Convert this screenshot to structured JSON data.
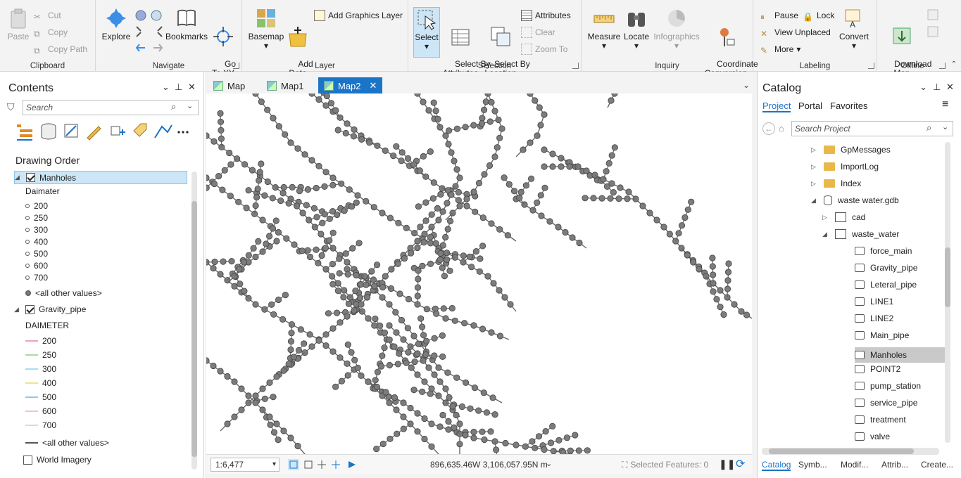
{
  "ribbon": {
    "clipboard": {
      "label": "Clipboard",
      "paste": "Paste",
      "cut": "Cut",
      "copy": "Copy",
      "copy_path": "Copy Path"
    },
    "navigate": {
      "label": "Navigate",
      "explore": "Explore",
      "bookmarks": "Bookmarks",
      "go_to_xy": "Go\nTo XY"
    },
    "layer": {
      "label": "Layer",
      "basemap": "Basemap",
      "add_data": "Add\nData",
      "add_graphics_layer": "Add Graphics Layer"
    },
    "selection": {
      "label": "Selection",
      "select": "Select",
      "select_by_attributes": "Select By\nAttributes",
      "select_by_location": "Select By\nLocation",
      "attributes": "Attributes",
      "clear": "Clear",
      "zoom_to": "Zoom To"
    },
    "inquiry": {
      "label": "Inquiry",
      "measure": "Measure",
      "locate": "Locate",
      "infographics": "Infographics",
      "coordinate_conversion": "Coordinate\nConversion"
    },
    "labeling": {
      "label": "Labeling",
      "pause": "Pause",
      "lock": "Lock",
      "view_unplaced": "View Unplaced",
      "more": "More",
      "convert": "Convert"
    },
    "offline": {
      "label": "Offline",
      "download_map": "Download\nMap"
    }
  },
  "contents": {
    "title": "Contents",
    "search_placeholder": "Search",
    "drawing_order": "Drawing Order",
    "manholes": {
      "name": "Manholes",
      "field": "Daimater",
      "classes": [
        "200",
        "250",
        "300",
        "400",
        "500",
        "600",
        "700"
      ],
      "other": "<all other values>"
    },
    "gravity_pipe": {
      "name": "Gravity_pipe",
      "field": "DAIMETER",
      "classes": [
        "200",
        "250",
        "300",
        "400",
        "500",
        "600",
        "700"
      ],
      "class_colors": [
        "#f2a0b5",
        "#a0e0a8",
        "#a8dcef",
        "#e8e59a",
        "#9cc3ea",
        "#efc0d8",
        "#bfead8"
      ],
      "other": "<all other values>"
    },
    "world_imagery": "World Imagery"
  },
  "tabs": [
    {
      "label": "Map"
    },
    {
      "label": "Map1"
    },
    {
      "label": "Map2"
    }
  ],
  "status": {
    "scale": "1:6,477",
    "coords": "896,635.46W 3,106,057.95N m",
    "selected_features": "Selected Features: 0"
  },
  "catalog": {
    "title": "Catalog",
    "tabs": [
      "Project",
      "Portal",
      "Favorites"
    ],
    "search_placeholder": "Search Project",
    "items": [
      {
        "label": "GpMessages"
      },
      {
        "label": "ImportLog"
      },
      {
        "label": "Index"
      },
      {
        "label": "waste water.gdb"
      },
      {
        "label": "cad"
      },
      {
        "label": "waste_water"
      },
      {
        "label": "force_main"
      },
      {
        "label": "Gravity_pipe"
      },
      {
        "label": "Leteral_pipe"
      },
      {
        "label": "LINE1"
      },
      {
        "label": "LINE2"
      },
      {
        "label": "Main_pipe"
      },
      {
        "label": "Manholes"
      },
      {
        "label": "POINT2"
      },
      {
        "label": "pump_station"
      },
      {
        "label": "service_pipe"
      },
      {
        "label": "treatment"
      },
      {
        "label": "valve"
      }
    ],
    "bottom_tabs": [
      "Catalog",
      "Symb...",
      "Modif...",
      "Attrib...",
      "Create..."
    ]
  }
}
